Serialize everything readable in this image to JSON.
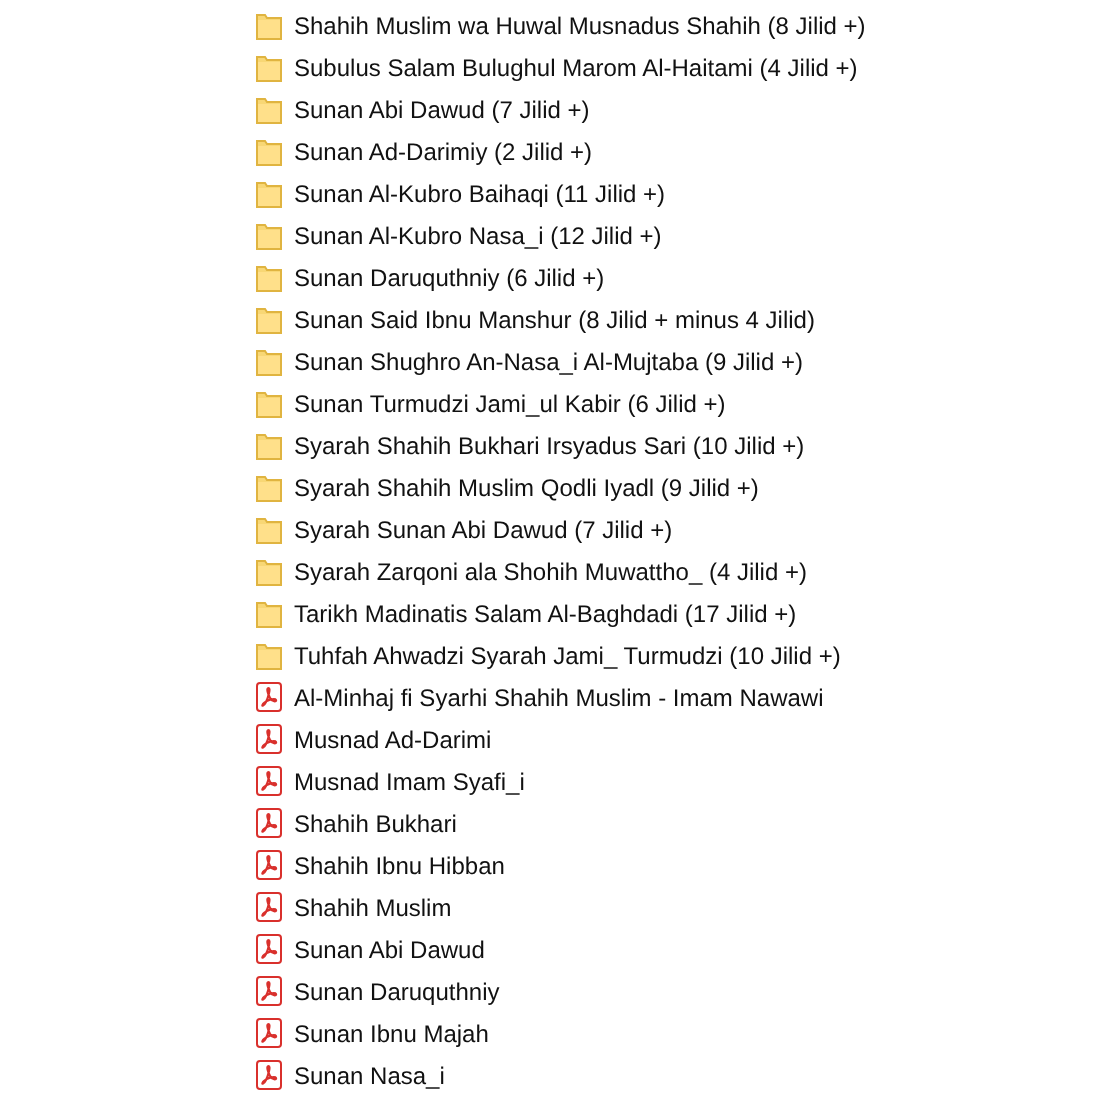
{
  "files": [
    {
      "kind": "folder",
      "name": "Shahih Muslim wa Huwal Musnadus Shahih (8 Jilid +)"
    },
    {
      "kind": "folder",
      "name": "Subulus Salam Bulughul Marom Al-Haitami (4 Jilid +)"
    },
    {
      "kind": "folder",
      "name": "Sunan Abi Dawud (7 Jilid +)"
    },
    {
      "kind": "folder",
      "name": "Sunan Ad-Darimiy (2 Jilid +)"
    },
    {
      "kind": "folder",
      "name": "Sunan Al-Kubro Baihaqi (11 Jilid +)"
    },
    {
      "kind": "folder",
      "name": "Sunan Al-Kubro Nasa_i (12 Jilid +)"
    },
    {
      "kind": "folder",
      "name": "Sunan Daruquthniy (6 Jilid +)"
    },
    {
      "kind": "folder",
      "name": "Sunan Said Ibnu Manshur (8 Jilid + minus 4 Jilid)"
    },
    {
      "kind": "folder",
      "name": "Sunan Shughro An-Nasa_i Al-Mujtaba (9 Jilid +)"
    },
    {
      "kind": "folder",
      "name": "Sunan Turmudzi Jami_ul Kabir (6 Jilid +)"
    },
    {
      "kind": "folder",
      "name": "Syarah Shahih Bukhari Irsyadus Sari (10 Jilid +)"
    },
    {
      "kind": "folder",
      "name": "Syarah Shahih Muslim Qodli Iyadl (9 Jilid +)"
    },
    {
      "kind": "folder",
      "name": "Syarah Sunan Abi Dawud (7 Jilid +)"
    },
    {
      "kind": "folder",
      "name": "Syarah Zarqoni ala Shohih Muwattho_ (4 Jilid +)"
    },
    {
      "kind": "folder",
      "name": "Tarikh Madinatis Salam Al-Baghdadi (17 Jilid +)"
    },
    {
      "kind": "folder",
      "name": "Tuhfah Ahwadzi Syarah Jami_ Turmudzi (10 Jilid +)"
    },
    {
      "kind": "pdf",
      "name": "Al-Minhaj fi Syarhi Shahih Muslim - Imam Nawawi"
    },
    {
      "kind": "pdf",
      "name": "Musnad Ad-Darimi"
    },
    {
      "kind": "pdf",
      "name": "Musnad Imam Syafi_i"
    },
    {
      "kind": "pdf",
      "name": "Shahih Bukhari"
    },
    {
      "kind": "pdf",
      "name": "Shahih Ibnu Hibban"
    },
    {
      "kind": "pdf",
      "name": "Shahih Muslim"
    },
    {
      "kind": "pdf",
      "name": "Sunan Abi Dawud"
    },
    {
      "kind": "pdf",
      "name": "Sunan Daruquthniy"
    },
    {
      "kind": "pdf",
      "name": "Sunan Ibnu Majah"
    },
    {
      "kind": "pdf",
      "name": "Sunan Nasa_i"
    }
  ]
}
